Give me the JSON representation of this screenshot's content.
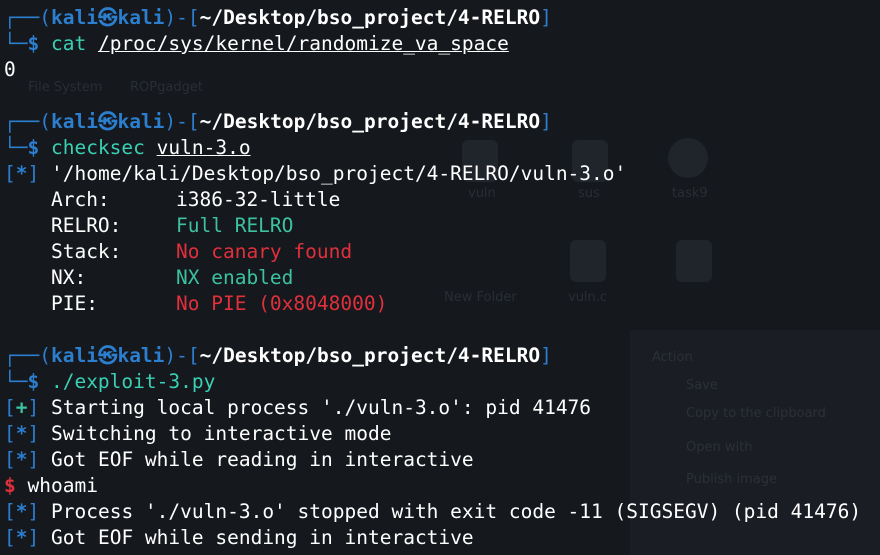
{
  "desktop_ghosts": {
    "file_system": "File System",
    "ropgadget": "ROPgadget",
    "vuln": "vuln",
    "sus": "sus",
    "task9": "task9",
    "new_folder": "New Folder",
    "vuln_c": "vuln.c",
    "action": "Action",
    "save": "Save",
    "copy": "Copy to the clipboard",
    "open_with": "Open with",
    "publish": "Publish image"
  },
  "prompt": {
    "user": "kali",
    "host": "kali",
    "symbol": "㉿"
  },
  "blocks": [
    {
      "path": "~/Desktop/bso_project/4-RELRO",
      "command": "cat",
      "argument": "/proc/sys/kernel/randomize_va_space",
      "output": "0"
    },
    {
      "path": "~/Desktop/bso_project/4-RELRO",
      "command": "checksec",
      "argument": "vuln-3.o",
      "info_line": "'/home/kali/Desktop/bso_project/4-RELRO/vuln-3.o'",
      "props": [
        {
          "key": "Arch:",
          "value": "i386-32-little"
        },
        {
          "key": "RELRO:",
          "value": "Full RELRO"
        },
        {
          "key": "Stack:",
          "value": "No canary found"
        },
        {
          "key": "NX:",
          "value": "NX enabled"
        },
        {
          "key": "PIE:",
          "value": "No PIE (0x8048000)"
        }
      ]
    },
    {
      "path": "~/Desktop/bso_project/4-RELRO",
      "command": "./exploit-3.py",
      "output_lines": [
        {
          "tag": "+",
          "text": "Starting local process './vuln-3.o': pid 41476"
        },
        {
          "tag": "*",
          "text": "Switching to interactive mode"
        },
        {
          "tag": "*",
          "text": "Got EOF while reading in interactive"
        }
      ],
      "shell_prompt": "$",
      "shell_command": "whoami",
      "final_lines": [
        {
          "tag": "*",
          "text": "Process './vuln-3.o' stopped with exit code -11 (SIGSEGV) (pid 41476)"
        },
        {
          "tag": "*",
          "text": "Got EOF while sending in interactive"
        }
      ]
    }
  ],
  "colors": {
    "background": "#15181d",
    "prompt_frame": "#2c7ecf",
    "ok_green": "#3cc2a0",
    "bad_red": "#e0303c"
  }
}
